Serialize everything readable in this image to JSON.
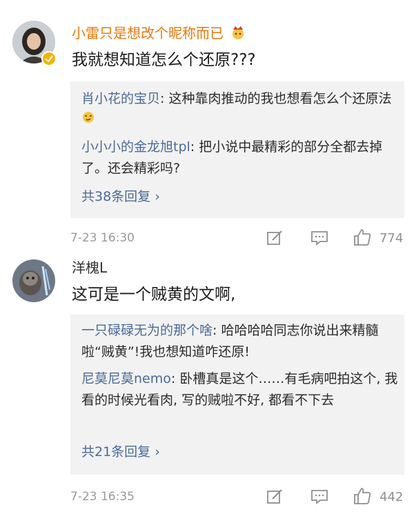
{
  "comments": [
    {
      "name": "小雷只是想改个昵称而已",
      "text": "我就想知道怎么个还原???",
      "replies": [
        {
          "name": "肖小花的宝贝",
          "text": ": 这种靠肉推动的我也想看怎么个还原法"
        },
        {
          "name": "小小小的金龙旭tpl",
          "text": ": 把小说中最精彩的部分全都去掉了。还会精彩吗?"
        }
      ],
      "more_label": "共38条回复 ›",
      "time": "7-23 16:30",
      "like_count": "774",
      "name_color": "#e8780c"
    },
    {
      "name": "洋槐L",
      "text": "这可是一个贼黄的文啊,",
      "replies": [
        {
          "name": "一只碌碌无为的那个啥",
          "text": ": 哈哈哈哈同志你说出来精髓啦“贼黄”!我也想知道咋还原!"
        },
        {
          "name": "尼莫尼莫nemo",
          "text": ": 卧槽真是这个……有毛病吧拍这个, 我看的时候光看肉, 写的贼啦不好, 都看不下去"
        }
      ],
      "more_label": "共21条回复 ›",
      "time": "7-23 16:35",
      "like_count": "442",
      "name_color": "#333333"
    }
  ],
  "icons": [
    "edit-icon",
    "comment-icon",
    "thumbs-up-icon",
    "crown-emoji-icon",
    "verified-badge-icon",
    "smirk-emoji-icon"
  ]
}
